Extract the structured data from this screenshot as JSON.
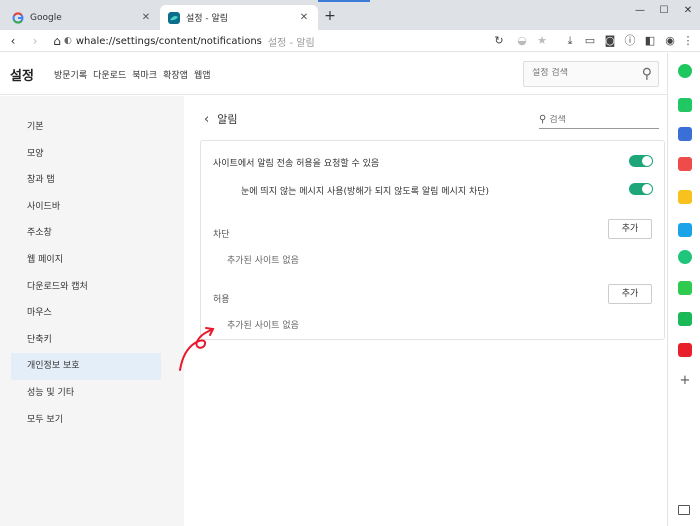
{
  "tabs": [
    {
      "title": "Google",
      "favicon": "google-icon"
    },
    {
      "title": "설정 - 알림",
      "favicon": "whale-icon"
    }
  ],
  "address": {
    "url": "whale://settings/content/notifications",
    "page_title": "설정 - 알림"
  },
  "header": {
    "title": "설정",
    "nav": [
      "방문기록",
      "다운로드",
      "북마크",
      "확장앱",
      "웹앱"
    ],
    "search_placeholder": "설정 검색"
  },
  "sidebar": {
    "items": [
      "기본",
      "모양",
      "창과 탭",
      "사이드바",
      "주소창",
      "웹 페이지",
      "다운로드와 캡처",
      "마우스",
      "단축키",
      "개인정보 보호",
      "성능 및 기타",
      "모두 보기"
    ],
    "active_index": 9
  },
  "content": {
    "title": "알림",
    "search_placeholder": "검색",
    "ask_permission_label": "사이트에서 알림 전송 허용을 요청할 수 있음",
    "quiet_messages_label": "눈에 띄지 않는 메시지 사용(방해가 되지 않도록 알림 메시지 차단)",
    "block": {
      "label": "차단",
      "add_button": "추가",
      "empty": "추가된 사이트 없음"
    },
    "allow": {
      "label": "허용",
      "add_button": "추가",
      "empty": "추가된 사이트 없음"
    }
  },
  "colors": {
    "toggle_on": "#1ea67a",
    "active_sidebar": "#e4eef8",
    "annotation": "#e8192c"
  }
}
